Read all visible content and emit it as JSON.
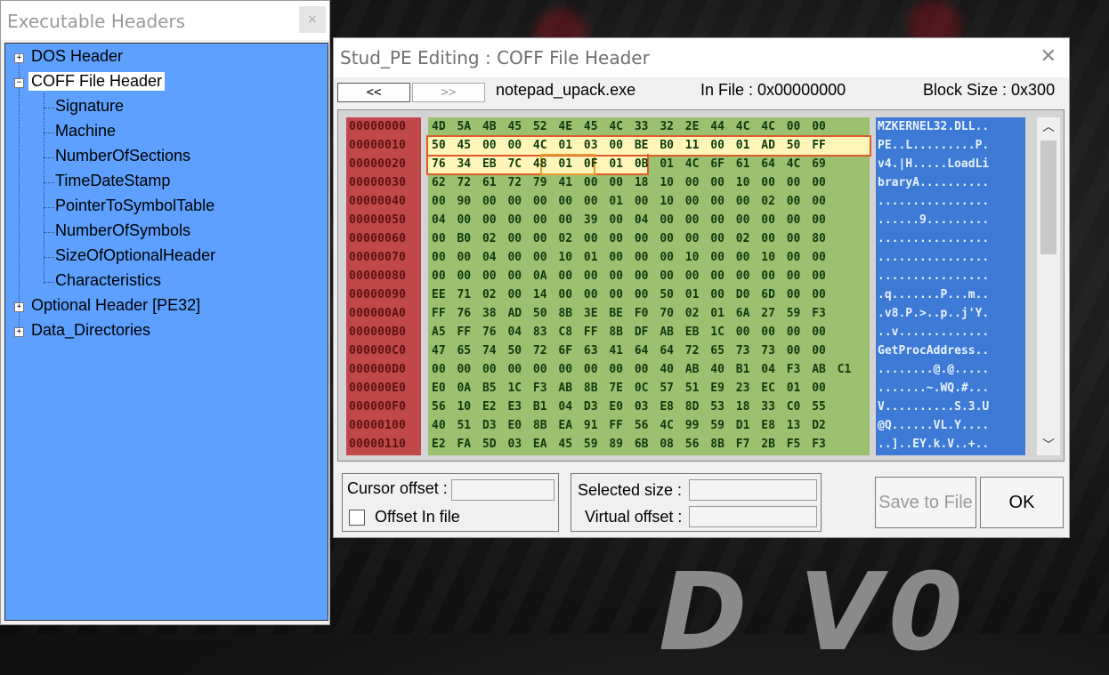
{
  "background": {
    "logo_text": "D V0"
  },
  "tree_window": {
    "title": "Executable Headers",
    "close_glyph": "×",
    "nodes": [
      {
        "label": "DOS Header",
        "expander": "+"
      },
      {
        "label": "COFF File Header",
        "expander": "−"
      },
      {
        "label": "Signature"
      },
      {
        "label": "Machine"
      },
      {
        "label": "NumberOfSections"
      },
      {
        "label": "TimeDateStamp"
      },
      {
        "label": "PointerToSymbolTable"
      },
      {
        "label": "NumberOfSymbols"
      },
      {
        "label": "SizeOfOptionalHeader"
      },
      {
        "label": "Characteristics"
      },
      {
        "label": "Optional Header [PE32]",
        "expander": "+"
      },
      {
        "label": "Data_Directories",
        "expander": "+"
      }
    ]
  },
  "editor": {
    "title": "Stud_PE Editing : COFF File Header",
    "close_glyph": "✕",
    "prev_label": "<<",
    "next_label": ">>",
    "file_name": "notepad_upack.exe",
    "in_file": "In File : 0x00000000",
    "block_size": "Block Size : 0x300",
    "hex_rows": [
      {
        "offset": "00000000",
        "hex": "4D 5A 4B 45 52 4E 45 4C 33 32 2E 44 4C 4C 00 00",
        "ascii": "MZKERNEL32.DLL.."
      },
      {
        "offset": "00000010",
        "hex": "50 45 00 00 4C 01 03 00 BE B0 11 00 01 AD 50 FF",
        "ascii": "PE..L.........P."
      },
      {
        "offset": "00000020",
        "hex": "76 34 EB 7C 48 01 0F 01 0B 01 4C 6F 61 64 4C 69",
        "ascii": "v4.|H.....LoadLi"
      },
      {
        "offset": "00000030",
        "hex": "62 72 61 72 79 41 00 00 18 10 00 00 10 00 00 00",
        "ascii": "braryA.........."
      },
      {
        "offset": "00000040",
        "hex": "00 90 00 00 00 00 00 01 00 10 00 00 00 02 00 00",
        "ascii": "................"
      },
      {
        "offset": "00000050",
        "hex": "04 00 00 00 00 00 39 00 04 00 00 00 00 00 00 00",
        "ascii": "......9........."
      },
      {
        "offset": "00000060",
        "hex": "00 B0 02 00 00 02 00 00 00 00 00 00 02 00 00 80",
        "ascii": "................"
      },
      {
        "offset": "00000070",
        "hex": "00 00 04 00 00 10 01 00 00 00 10 00 00 10 00 00",
        "ascii": "................"
      },
      {
        "offset": "00000080",
        "hex": "00 00 00 00 0A 00 00 00 00 00 00 00 00 00 00 00",
        "ascii": "................"
      },
      {
        "offset": "00000090",
        "hex": "EE 71 02 00 14 00 00 00 00 50 01 00 D0 6D 00 00",
        "ascii": ".q.......P...m.."
      },
      {
        "offset": "000000A0",
        "hex": "FF 76 38 AD 50 8B 3E BE F0 70 02 01 6A 27 59 F3",
        "ascii": ".v8.P.>..p..j'Y."
      },
      {
        "offset": "000000B0",
        "hex": "A5 FF 76 04 83 C8 FF 8B DF AB EB 1C 00 00 00 00",
        "ascii": "..v............."
      },
      {
        "offset": "000000C0",
        "hex": "47 65 74 50 72 6F 63 41 64 64 72 65 73 73 00 00",
        "ascii": "GetProcAddress.."
      },
      {
        "offset": "000000D0",
        "hex": "00 00 00 00 00 00 00 00 00 40 AB 40 B1 04 F3 AB C1",
        "ascii": "........@.@....."
      },
      {
        "offset": "000000E0",
        "hex": "E0 0A B5 1C F3 AB 8B 7E 0C 57 51 E9 23 EC 01 00",
        "ascii": ".......~.WQ.#..."
      },
      {
        "offset": "000000F0",
        "hex": "56 10 E2 E3 B1 04 D3 E0 03 E8 8D 53 18 33 C0 55",
        "ascii": "V..........S.3.U"
      },
      {
        "offset": "00000100",
        "hex": "40 51 D3 E0 8B EA 91 FF 56 4C 99 59 D1 E8 13 D2",
        "ascii": "@Q......VL.Y...."
      },
      {
        "offset": "00000110",
        "hex": "E2 FA 5D 03 EA 45 59 89 6B 08 56 8B F7 2B F5 F3",
        "ascii": "..]..EY.k.V..+.."
      }
    ],
    "scroll_up": "︿",
    "scroll_down": "﹀",
    "cursor_offset_label": "Cursor offset :",
    "cursor_offset_value": "",
    "offset_in_file_label": "Offset In file",
    "offset_in_file_checked": false,
    "selected_size_label": "Selected size :",
    "selected_size_value": "",
    "virtual_offset_label": "Virtual offset :",
    "virtual_offset_value": "",
    "save_label": "Save to File",
    "ok_label": "OK"
  }
}
